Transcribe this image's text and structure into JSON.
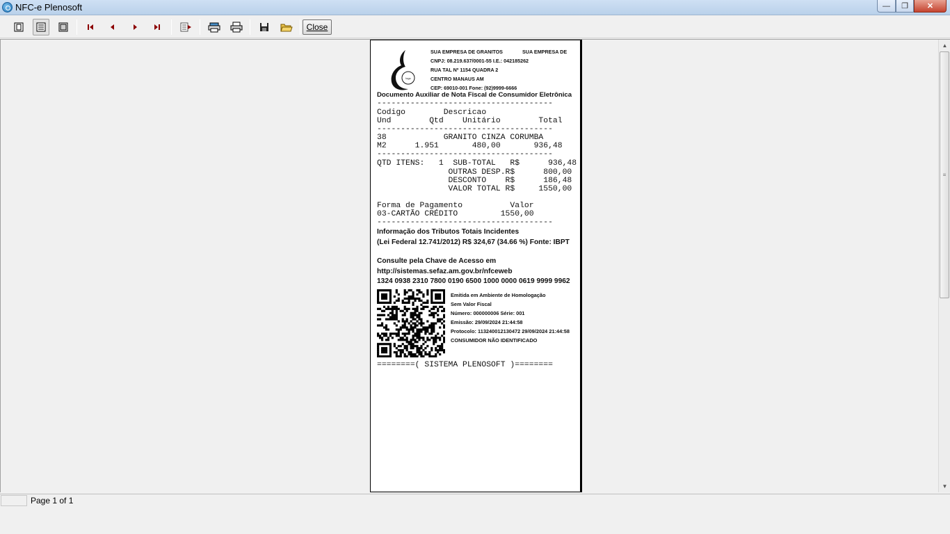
{
  "window": {
    "title": "NFC-e Plenosoft",
    "icon": "app-icon"
  },
  "toolbar": {
    "close_label": "Close",
    "icons": [
      "one-page-icon",
      "page-width-icon",
      "full-page-icon",
      "first-page-icon",
      "previous-page-icon",
      "next-page-icon",
      "last-page-icon",
      "goto-page-icon",
      "printer-setup-icon",
      "print-icon",
      "save-icon",
      "open-icon"
    ]
  },
  "receipt": {
    "company_name": "SUA EMPRESA DE GRANITOS",
    "company_name2": "SUA EMPRESA DE",
    "cnpj": "CNPJ: 08.219.637/0001-55 I.E.: 042185262",
    "street": "RUA TAL    Nº 1154 QUADRA 2",
    "district": "CENTRO        MANAUS AM",
    "cep": "CEP: 69010-001    Fone: (92)9999-6666",
    "doc_title": "Documento Auxiliar de Nota Fiscal de Consumidor Eletrônica",
    "dash_line": "-------------------------------------",
    "col_head1": "Codigo        Descricao",
    "col_head2": "Und        Qtd    Unitário        Total",
    "item_line1": "38            GRANITO CINZA CORUMBA",
    "item_line2": "M2      1.951       480,00       936,48",
    "totals1": "QTD ITENS:   1  SUB-TOTAL   R$      936,48",
    "totals2": "               OUTRAS DESP.R$      800,00",
    "totals3": "               DESCONTO    R$      186,48",
    "totals4": "               VALOR TOTAL R$     1550,00",
    "pay_head": "Forma de Pagamento          Valor",
    "pay_line": "03-CARTÃO CRÉDITO         1550,00",
    "tributos_title": "Informação dos Tributos Totais Incidentes",
    "tributos_line": "(Lei Federal 12.741/2012) R$ 324,67 (34.66 %) Fonte: IBPT",
    "consulta_title": "Consulte pela Chave de Acesso em",
    "consulta_url": "http://sistemas.sefaz.am.gov.br/nfceweb",
    "chave": " 1324 0938 2310 7800 0190 6500 1000 0000 0619 9999 9962",
    "homolog1": "Emitida em Ambiente de Homologação",
    "homolog2": "Sem Valor Fiscal",
    "numero": "Número: 000000006 Série: 001",
    "emissao": "Emissão: 29/09/2024 21:44:58",
    "protocolo": "Protocolo: 113240012130472 29/09/2024 21:44:58",
    "consumidor": "CONSUMIDOR NÃO IDENTIFICADO",
    "footer": "========( SISTEMA PLENOSOFT )========"
  },
  "status": {
    "page_text": "Page 1 of 1"
  }
}
